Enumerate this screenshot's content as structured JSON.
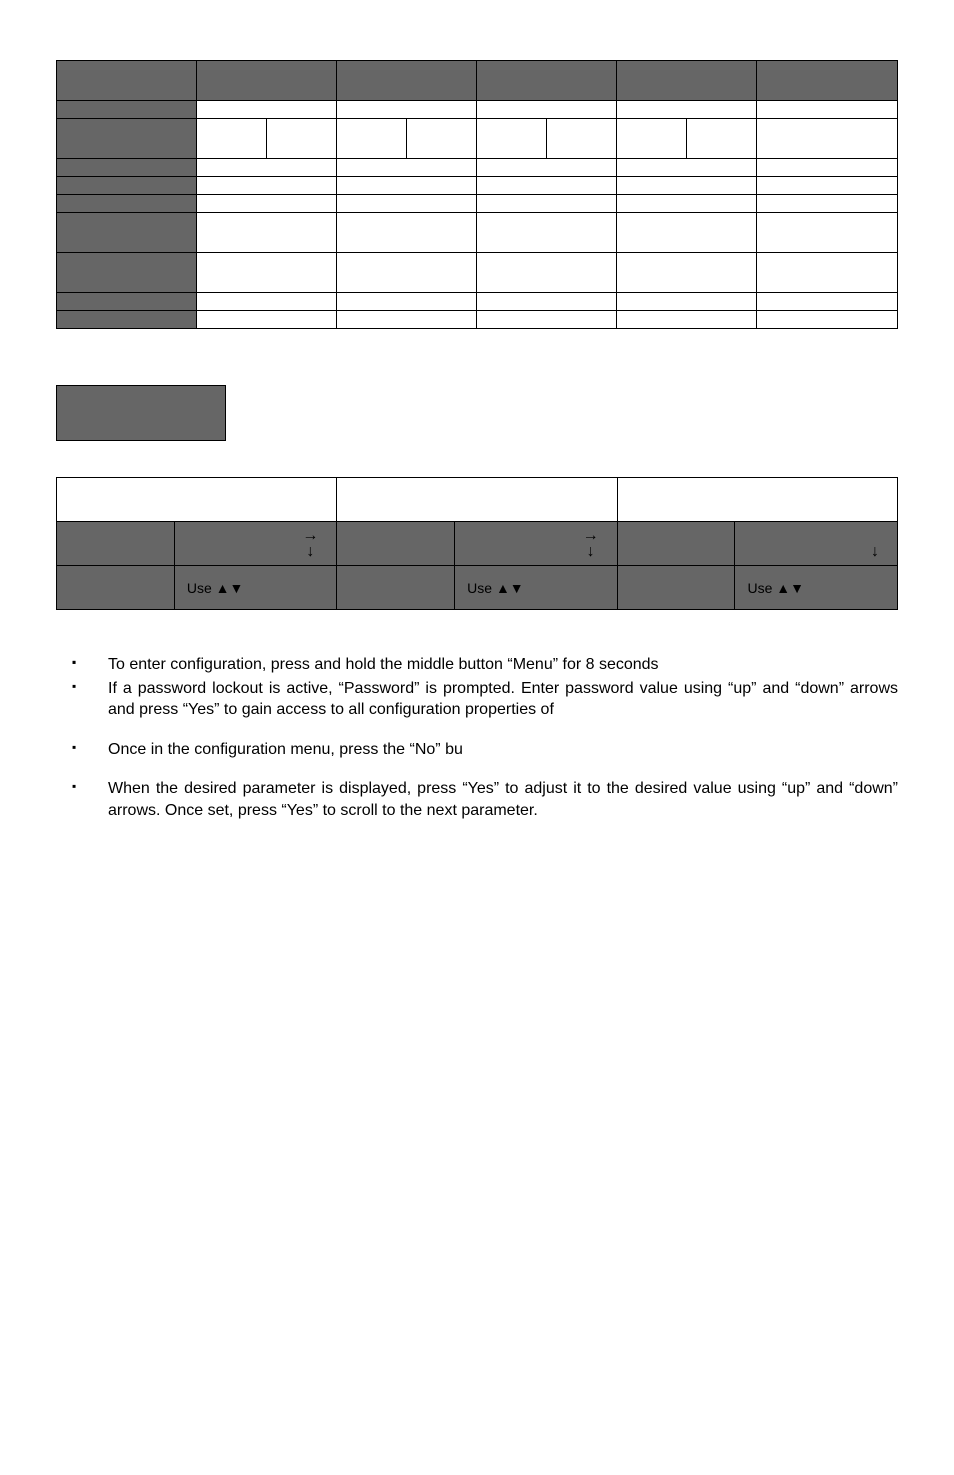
{
  "navcell": {
    "right_arrow": "→",
    "down_arrow": "↓",
    "use_label": "Use ▲▼"
  },
  "instructions": {
    "i1": "",
    "i2": "To enter configuration, press and hold the middle button “Menu” for 8 seconds",
    "i3": "If a password lockout is active, “Password” is prompted. Enter password value using “up” and “down” arrows and press “Yes” to gain access to all configuration properties of",
    "i4": "Once in the configuration menu, press the “No” bu",
    "i5": "When the desired parameter is displayed, press “Yes” to adjust it to the desired value using “up” and “down” arrows. Once set, press “Yes” to scroll to the next parameter."
  }
}
